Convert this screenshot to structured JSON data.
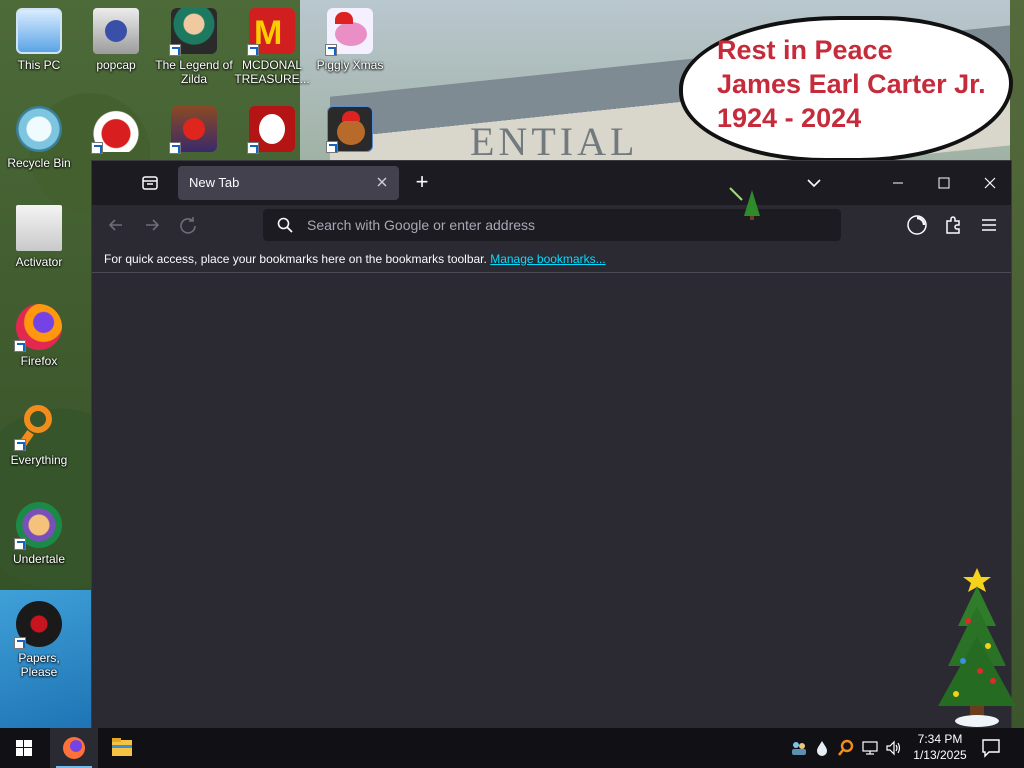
{
  "desktop": {
    "icons": [
      {
        "label": "This PC",
        "icon": "this-pc-icon"
      },
      {
        "label": "popcap",
        "icon": "popcap-icon"
      },
      {
        "label": "The Legend of Zilda",
        "icon": "legend-of-zilda-icon"
      },
      {
        "label": "MCDONAL TREASURE...",
        "icon": "mcdonald-treasure-icon"
      },
      {
        "label": "Piggly Xmas",
        "icon": "piggly-xmas-icon"
      },
      {
        "label": "Recycle Bin",
        "icon": "recycle-bin-icon"
      },
      {
        "label": "",
        "icon": "chicken-invaders-icon"
      },
      {
        "label": "",
        "icon": "angry-birds-seasons-icon"
      },
      {
        "label": "",
        "icon": "snowman-icon"
      },
      {
        "label": "",
        "icon": "teddy-bear-icon"
      },
      {
        "label": "Activator",
        "icon": "activator-icon"
      },
      {
        "label": "Firefox",
        "icon": "firefox-icon"
      },
      {
        "label": "Everything",
        "icon": "everything-search-icon"
      },
      {
        "label": "Undertale",
        "icon": "undertale-icon"
      },
      {
        "label": "Papers, Please",
        "icon": "papers-please-icon"
      }
    ],
    "bubble_lines": [
      "Rest in Peace",
      "James Earl Carter Jr.",
      "1924 - 2024"
    ],
    "bubble_color": "#c62b3b"
  },
  "browser": {
    "tab_title": "New Tab",
    "new_tab_label": "+",
    "url_placeholder": "Search with Google or enter address",
    "url_value": "",
    "bookmarks_message": "For quick access, place your bookmarks here on the bookmarks toolbar.",
    "manage_bookmarks_label": "Manage bookmarks...",
    "colors": {
      "frame": "#1c1b22",
      "toolbar": "#2b2a33",
      "tab_active": "#42414d",
      "link": "#00ddff"
    }
  },
  "taskbar": {
    "time": "7:34 PM",
    "date": "1/13/2025",
    "pinned": [
      "firefox-icon",
      "file-explorer-icon"
    ],
    "tray_icons": [
      "people-icon",
      "water-drop-icon",
      "everything-search-icon",
      "network-icon",
      "volume-icon"
    ]
  }
}
